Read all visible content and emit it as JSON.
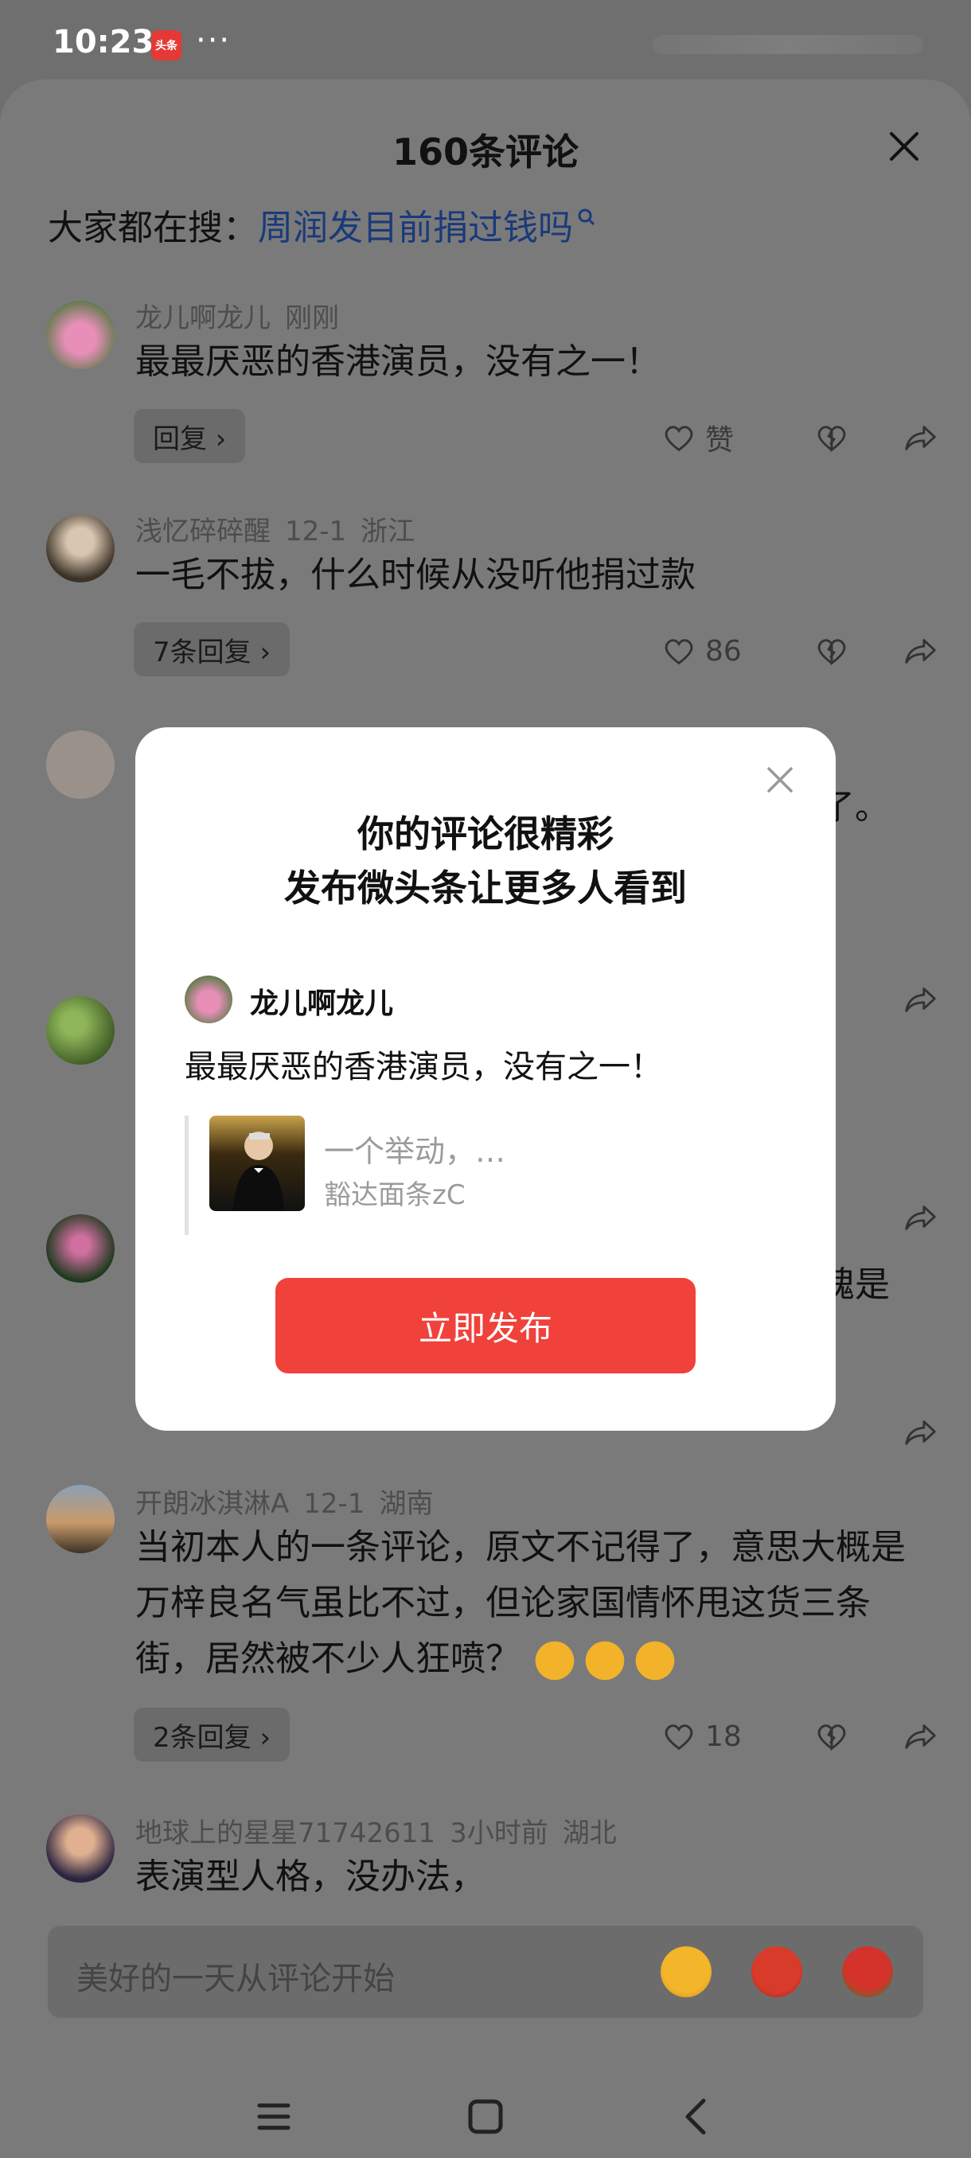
{
  "status_bar": {
    "time": "10:23",
    "app_badge": "头条",
    "more": "···"
  },
  "sheet": {
    "title": "160条评论",
    "search_prefix": "大家都在搜：",
    "search_term": "周润发目前捐过钱吗"
  },
  "comments": [
    {
      "user": "龙儿啊龙儿",
      "time": "刚刚",
      "location": "",
      "text": "最最厌恶的香港演员，没有之一！",
      "reply_label": "回复 ›",
      "likes": "赞"
    },
    {
      "user": "浅忆碎碎醒",
      "time": "12-1",
      "location": "浙江",
      "text": "一毛不拔，什么时候从没听他捐过款",
      "reply_label": "7条回复 ›",
      "likes": "86"
    },
    {
      "partial_text": "了。"
    },
    {
      "partial_text": ""
    },
    {
      "partial_text": "愧是"
    },
    {
      "user": "开朗冰淇淋A",
      "time": "12-1",
      "location": "湖南",
      "text": "当初本人的一条评论，原文不记得了，意思大概是万梓良名气虽比不过，但论家国情怀甩这货三条街，居然被不少人狂喷？",
      "reply_label": "2条回复 ›",
      "likes": "18"
    },
    {
      "user": "地球上的星星71742611",
      "time": "3小时前",
      "location": "湖北",
      "text": "表演型人格，没办法，",
      "reply_label": "",
      "likes": ""
    }
  ],
  "input_bar": {
    "placeholder": "美好的一天从评论开始"
  },
  "modal": {
    "title_line1": "你的评论很精彩",
    "title_line2": "发布微头条让更多人看到",
    "user": "龙儿啊龙儿",
    "text": "最最厌恶的香港演员，没有之一！",
    "quote_title": "一个举动，…",
    "quote_source": "豁达面条zC",
    "publish_label": "立即发布"
  },
  "icons": {
    "close": "close-icon",
    "like": "heart-icon",
    "dislike": "broken-heart-icon",
    "share": "share-icon",
    "menu": "menu-icon",
    "home": "home-icon",
    "back": "back-icon"
  },
  "colors": {
    "accent": "#f0413a",
    "link": "#1a3a7a",
    "overlay": "#6f6f6f"
  }
}
